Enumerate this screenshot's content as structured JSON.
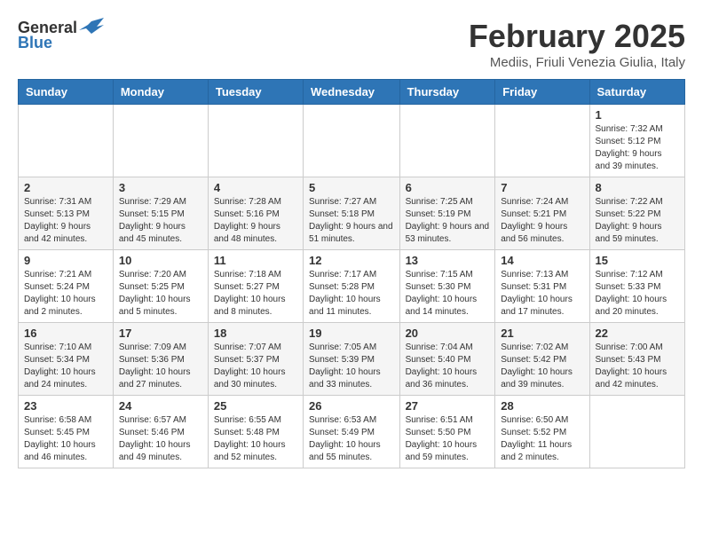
{
  "header": {
    "logo_general": "General",
    "logo_blue": "Blue",
    "month_title": "February 2025",
    "location": "Mediis, Friuli Venezia Giulia, Italy"
  },
  "days_of_week": [
    "Sunday",
    "Monday",
    "Tuesday",
    "Wednesday",
    "Thursday",
    "Friday",
    "Saturday"
  ],
  "weeks": [
    [
      {
        "day": "",
        "info": ""
      },
      {
        "day": "",
        "info": ""
      },
      {
        "day": "",
        "info": ""
      },
      {
        "day": "",
        "info": ""
      },
      {
        "day": "",
        "info": ""
      },
      {
        "day": "",
        "info": ""
      },
      {
        "day": "1",
        "info": "Sunrise: 7:32 AM\nSunset: 5:12 PM\nDaylight: 9 hours and 39 minutes."
      }
    ],
    [
      {
        "day": "2",
        "info": "Sunrise: 7:31 AM\nSunset: 5:13 PM\nDaylight: 9 hours and 42 minutes."
      },
      {
        "day": "3",
        "info": "Sunrise: 7:29 AM\nSunset: 5:15 PM\nDaylight: 9 hours and 45 minutes."
      },
      {
        "day": "4",
        "info": "Sunrise: 7:28 AM\nSunset: 5:16 PM\nDaylight: 9 hours and 48 minutes."
      },
      {
        "day": "5",
        "info": "Sunrise: 7:27 AM\nSunset: 5:18 PM\nDaylight: 9 hours and 51 minutes."
      },
      {
        "day": "6",
        "info": "Sunrise: 7:25 AM\nSunset: 5:19 PM\nDaylight: 9 hours and 53 minutes."
      },
      {
        "day": "7",
        "info": "Sunrise: 7:24 AM\nSunset: 5:21 PM\nDaylight: 9 hours and 56 minutes."
      },
      {
        "day": "8",
        "info": "Sunrise: 7:22 AM\nSunset: 5:22 PM\nDaylight: 9 hours and 59 minutes."
      }
    ],
    [
      {
        "day": "9",
        "info": "Sunrise: 7:21 AM\nSunset: 5:24 PM\nDaylight: 10 hours and 2 minutes."
      },
      {
        "day": "10",
        "info": "Sunrise: 7:20 AM\nSunset: 5:25 PM\nDaylight: 10 hours and 5 minutes."
      },
      {
        "day": "11",
        "info": "Sunrise: 7:18 AM\nSunset: 5:27 PM\nDaylight: 10 hours and 8 minutes."
      },
      {
        "day": "12",
        "info": "Sunrise: 7:17 AM\nSunset: 5:28 PM\nDaylight: 10 hours and 11 minutes."
      },
      {
        "day": "13",
        "info": "Sunrise: 7:15 AM\nSunset: 5:30 PM\nDaylight: 10 hours and 14 minutes."
      },
      {
        "day": "14",
        "info": "Sunrise: 7:13 AM\nSunset: 5:31 PM\nDaylight: 10 hours and 17 minutes."
      },
      {
        "day": "15",
        "info": "Sunrise: 7:12 AM\nSunset: 5:33 PM\nDaylight: 10 hours and 20 minutes."
      }
    ],
    [
      {
        "day": "16",
        "info": "Sunrise: 7:10 AM\nSunset: 5:34 PM\nDaylight: 10 hours and 24 minutes."
      },
      {
        "day": "17",
        "info": "Sunrise: 7:09 AM\nSunset: 5:36 PM\nDaylight: 10 hours and 27 minutes."
      },
      {
        "day": "18",
        "info": "Sunrise: 7:07 AM\nSunset: 5:37 PM\nDaylight: 10 hours and 30 minutes."
      },
      {
        "day": "19",
        "info": "Sunrise: 7:05 AM\nSunset: 5:39 PM\nDaylight: 10 hours and 33 minutes."
      },
      {
        "day": "20",
        "info": "Sunrise: 7:04 AM\nSunset: 5:40 PM\nDaylight: 10 hours and 36 minutes."
      },
      {
        "day": "21",
        "info": "Sunrise: 7:02 AM\nSunset: 5:42 PM\nDaylight: 10 hours and 39 minutes."
      },
      {
        "day": "22",
        "info": "Sunrise: 7:00 AM\nSunset: 5:43 PM\nDaylight: 10 hours and 42 minutes."
      }
    ],
    [
      {
        "day": "23",
        "info": "Sunrise: 6:58 AM\nSunset: 5:45 PM\nDaylight: 10 hours and 46 minutes."
      },
      {
        "day": "24",
        "info": "Sunrise: 6:57 AM\nSunset: 5:46 PM\nDaylight: 10 hours and 49 minutes."
      },
      {
        "day": "25",
        "info": "Sunrise: 6:55 AM\nSunset: 5:48 PM\nDaylight: 10 hours and 52 minutes."
      },
      {
        "day": "26",
        "info": "Sunrise: 6:53 AM\nSunset: 5:49 PM\nDaylight: 10 hours and 55 minutes."
      },
      {
        "day": "27",
        "info": "Sunrise: 6:51 AM\nSunset: 5:50 PM\nDaylight: 10 hours and 59 minutes."
      },
      {
        "day": "28",
        "info": "Sunrise: 6:50 AM\nSunset: 5:52 PM\nDaylight: 11 hours and 2 minutes."
      },
      {
        "day": "",
        "info": ""
      }
    ]
  ]
}
